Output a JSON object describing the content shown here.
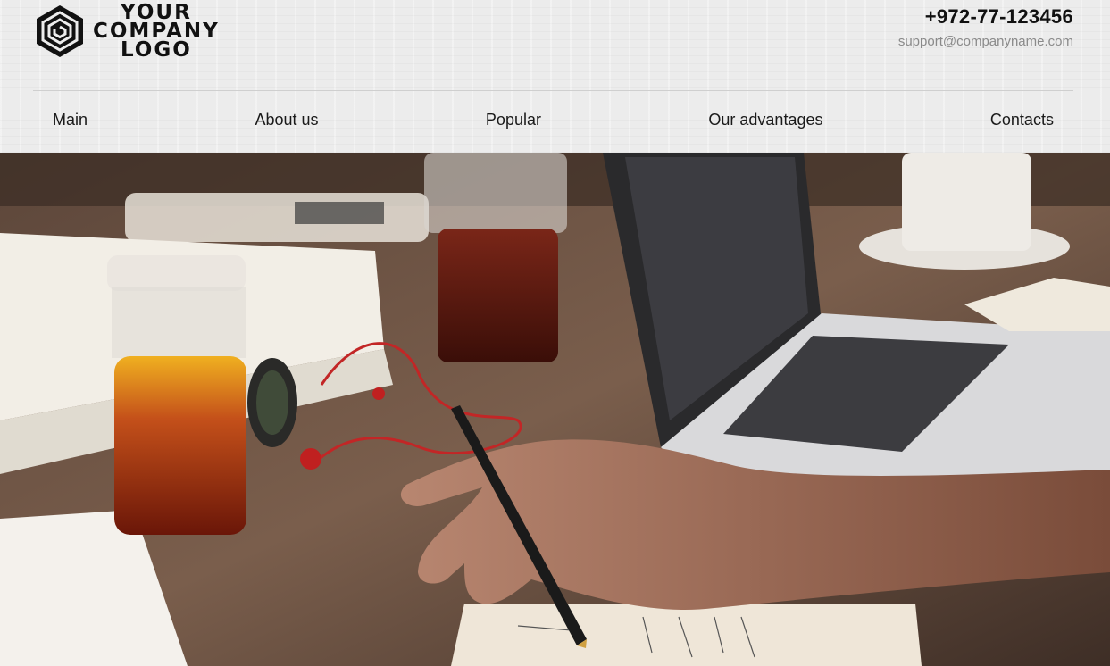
{
  "logo": {
    "line1": "YOUR",
    "line2": "COMPANY",
    "line3": "LOGO",
    "icon": "hexagon-spiral-logo"
  },
  "contact": {
    "phone": "+972-77-123456",
    "email": "support@companyname.com"
  },
  "nav": {
    "items": [
      {
        "label": "Main"
      },
      {
        "label": "About us"
      },
      {
        "label": "Popular"
      },
      {
        "label": "Our advantages"
      },
      {
        "label": "Contacts"
      }
    ]
  },
  "hero": {
    "description_icon": "workspace-photo"
  },
  "colors": {
    "header_bg": "#ececec",
    "text": "#111111",
    "email": "#8a8a8a"
  }
}
